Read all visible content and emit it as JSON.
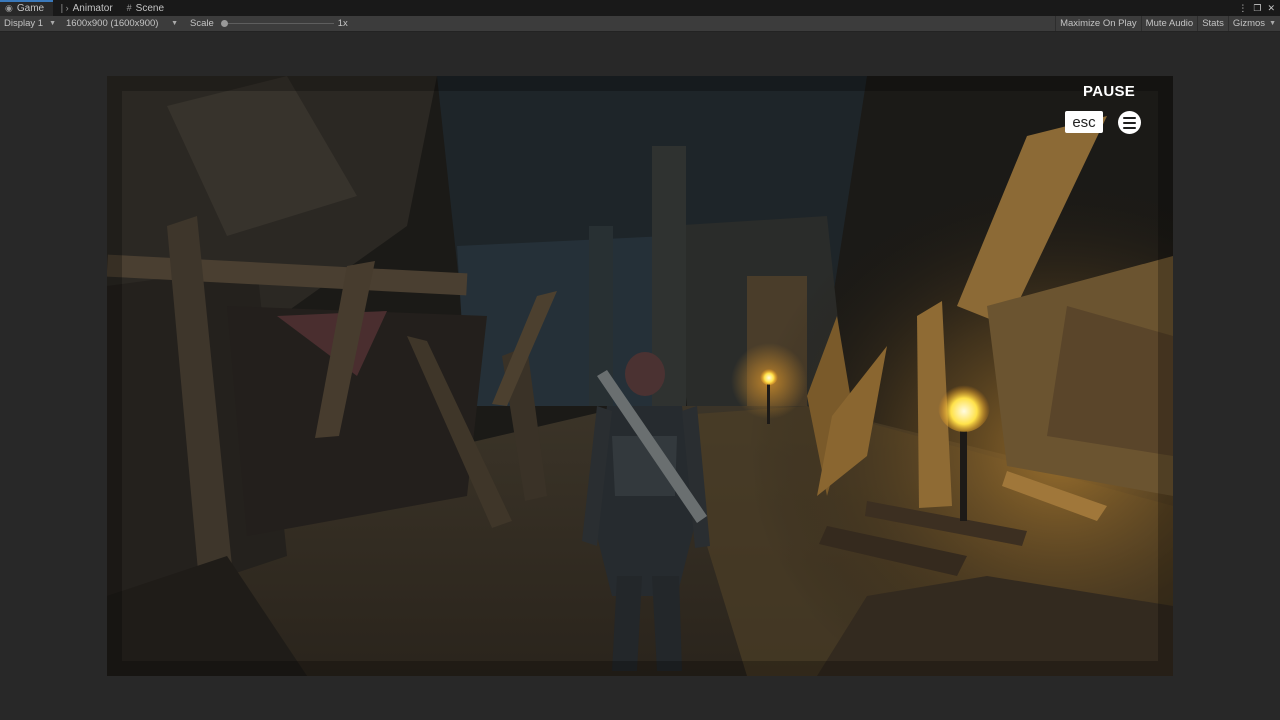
{
  "tabs": [
    {
      "label": "Game",
      "icon": "gamepad-icon",
      "active": true
    },
    {
      "label": "Animator",
      "icon": "animator-icon",
      "active": false
    },
    {
      "label": "Scene",
      "icon": "scene-grid-icon",
      "active": false
    }
  ],
  "toolbar": {
    "display": "Display 1",
    "resolution": "1600x900 (1600x900)",
    "scale_label": "Scale",
    "scale_value": "1x",
    "scale_fraction": 0,
    "maximize": "Maximize On Play",
    "mute": "Mute Audio",
    "stats": "Stats",
    "gizmos": "Gizmos"
  },
  "game_hud": {
    "pause_label": "PAUSE",
    "esc_key": "esc",
    "menu_icon": "hamburger-menu-icon"
  },
  "colors": {
    "active_tab_accent": "#3a79bb",
    "torch_flame": "#ffe24a",
    "scene_shadow": "#171410"
  }
}
